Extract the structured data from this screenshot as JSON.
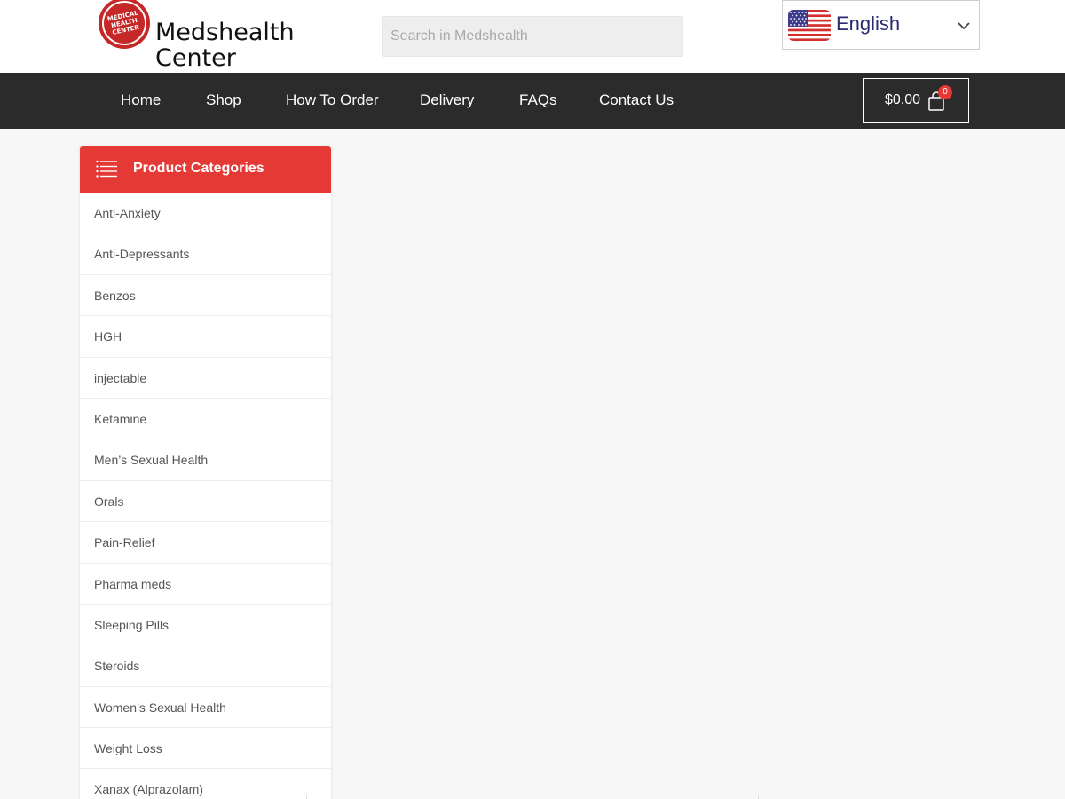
{
  "header": {
    "logo_text_line1": "Medshealth",
    "logo_text_line2": "Center",
    "logo_badge_line1": "MEDICAL",
    "logo_badge_line2": "HEALTH",
    "logo_badge_line3": "CENTER",
    "search_placeholder": "Search in Medshealth",
    "language": "English",
    "language_icon": "us-flag-icon"
  },
  "nav": {
    "items": [
      {
        "label": "Home"
      },
      {
        "label": "Shop"
      },
      {
        "label": "How To Order"
      },
      {
        "label": "Delivery"
      },
      {
        "label": "FAQs"
      },
      {
        "label": "Contact Us"
      }
    ],
    "cart_total": "$0.00",
    "cart_count": "0"
  },
  "sidebar": {
    "title": "Product Categories",
    "categories": [
      {
        "label": "Anti-Anxiety"
      },
      {
        "label": "Anti-Depressants"
      },
      {
        "label": "Benzos"
      },
      {
        "label": "HGH"
      },
      {
        "label": "injectable"
      },
      {
        "label": "Ketamine"
      },
      {
        "label": "Men’s Sexual Health"
      },
      {
        "label": "Orals"
      },
      {
        "label": "Pain-Relief"
      },
      {
        "label": "Pharma meds"
      },
      {
        "label": "Sleeping Pills"
      },
      {
        "label": "Steroids"
      },
      {
        "label": "Women’s Sexual Health"
      },
      {
        "label": "Weight Loss"
      },
      {
        "label": "Xanax (Alprazolam)"
      }
    ]
  },
  "colors": {
    "accent": "#e53935",
    "nav_bg": "#2b2b2b",
    "page_bg": "#f7f7f7",
    "language_text": "#2b2a72"
  }
}
